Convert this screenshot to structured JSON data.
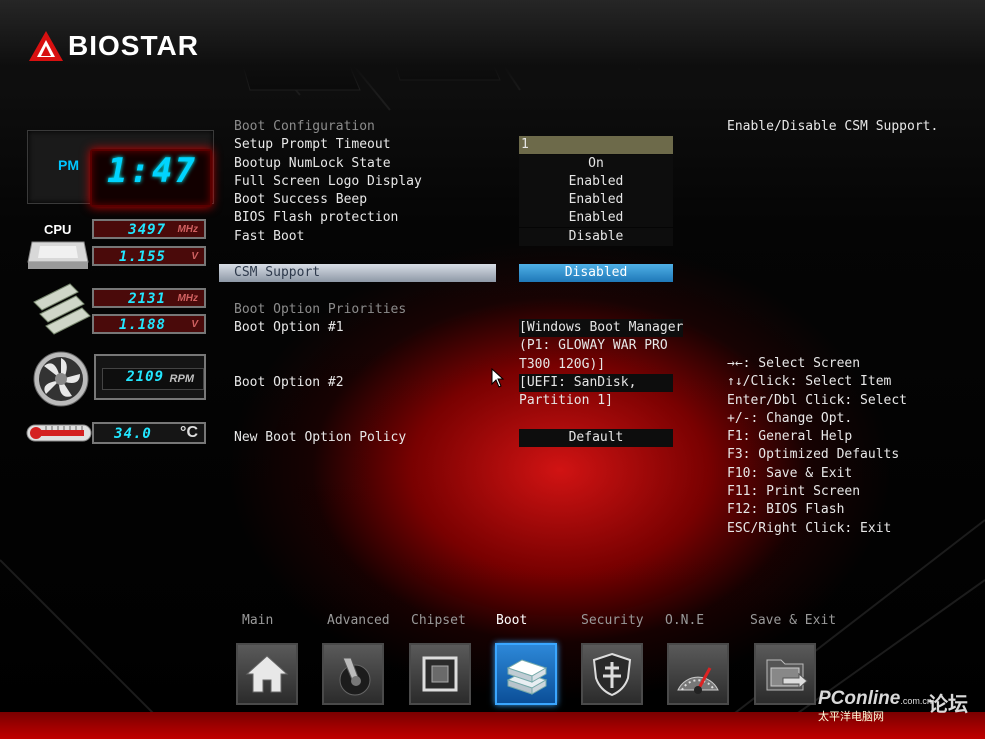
{
  "brand": {
    "logo_text": "BIOSTAR"
  },
  "status": {
    "clock": {
      "ampm": "PM",
      "time": "1:47"
    },
    "cpu_label": "CPU",
    "cpu_freq": {
      "value": "3497",
      "unit": "MHz"
    },
    "cpu_volt": {
      "value": "1.155",
      "unit": "V"
    },
    "mem_freq": {
      "value": "2131",
      "unit": "MHz"
    },
    "mem_volt": {
      "value": "1.188",
      "unit": "V"
    },
    "fan": {
      "value": "2109",
      "unit": "RPM"
    },
    "temp": {
      "value": "34.0",
      "unit": "°C"
    }
  },
  "settings": {
    "boot_config_heading": "Boot Configuration",
    "rows": [
      {
        "label": "Setup Prompt Timeout",
        "value": "1"
      },
      {
        "label": "Bootup NumLock State",
        "value": "On"
      },
      {
        "label": "Full Screen Logo Display",
        "value": "Enabled"
      },
      {
        "label": "Boot Success Beep",
        "value": "Enabled"
      },
      {
        "label": "BIOS Flash protection",
        "value": "Enabled"
      },
      {
        "label": "Fast Boot",
        "value": "Disable"
      }
    ],
    "csm": {
      "label": "CSM Support",
      "value": "Disabled"
    },
    "priorities_heading": "Boot Option Priorities",
    "boot_option_1": {
      "label": "Boot Option #1",
      "value_lines": [
        "[Windows Boot Manager",
        "(P1: GLOWAY WAR PRO",
        "T300 120G)]"
      ]
    },
    "boot_option_2": {
      "label": "Boot Option #2",
      "value_lines": [
        "[UEFI: SanDisk,",
        "Partition 1]"
      ]
    },
    "new_boot_policy": {
      "label": "New Boot Option Policy",
      "value": "Default"
    }
  },
  "help": {
    "description": "Enable/Disable CSM Support.",
    "keys": [
      "→←: Select Screen",
      "↑↓/Click: Select Item",
      "Enter/Dbl Click: Select",
      "+/-: Change Opt.",
      "F1: General Help",
      "F3: Optimized Defaults",
      "F10: Save & Exit",
      "F11: Print Screen",
      "F12: BIOS Flash",
      "ESC/Right Click: Exit"
    ]
  },
  "tabs": [
    {
      "label": "Main",
      "icon": "home-icon"
    },
    {
      "label": "Advanced",
      "icon": "joystick-icon"
    },
    {
      "label": "Chipset",
      "icon": "chip-icon"
    },
    {
      "label": "Boot",
      "icon": "boot-drive-icon",
      "active": true
    },
    {
      "label": "Security",
      "icon": "shield-icon"
    },
    {
      "label": "O.N.E",
      "icon": "speedometer-icon"
    },
    {
      "label": "Save & Exit",
      "icon": "folder-exit-icon"
    }
  ],
  "watermark": {
    "brand": "PConline",
    "domain": ".com.cn",
    "subtitle": "太平洋电脑网",
    "forum": "论坛"
  },
  "colors": {
    "accent_red": "#cc0000",
    "selected_blue": "#2a86cc",
    "lcd_cyan": "#22e6ff"
  }
}
